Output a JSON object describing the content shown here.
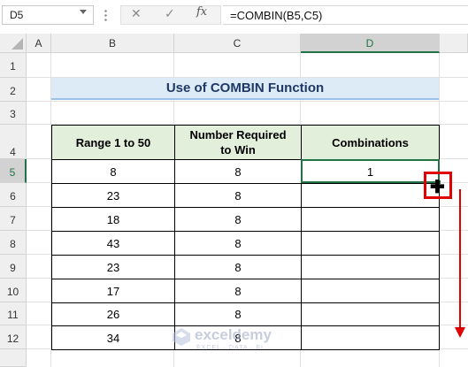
{
  "formula_bar": {
    "name_box": "D5",
    "cancel_icon": "✕",
    "enter_icon": "✓",
    "fx_label": "fx",
    "formula": "=COMBIN(B5,C5)"
  },
  "columns": [
    "A",
    "B",
    "C",
    "D"
  ],
  "rows": [
    "1",
    "2",
    "3",
    "4",
    "5",
    "6",
    "7",
    "8",
    "9",
    "10",
    "11",
    "12"
  ],
  "selected_column": "D",
  "selected_row": "5",
  "title": "Use of COMBIN Function",
  "table": {
    "headers": [
      "Range 1 to 50",
      "Number Required\nto Win",
      "Combinations"
    ],
    "rows": [
      {
        "range": "8",
        "required": "8",
        "combinations": "1"
      },
      {
        "range": "23",
        "required": "8",
        "combinations": ""
      },
      {
        "range": "18",
        "required": "8",
        "combinations": ""
      },
      {
        "range": "43",
        "required": "8",
        "combinations": ""
      },
      {
        "range": "23",
        "required": "8",
        "combinations": ""
      },
      {
        "range": "17",
        "required": "8",
        "combinations": ""
      },
      {
        "range": "26",
        "required": "8",
        "combinations": ""
      },
      {
        "range": "34",
        "required": "8",
        "combinations": ""
      }
    ]
  },
  "annotation": {
    "cursor_icon": "crosshair-plus-icon",
    "highlight_color": "#e00000",
    "arrow_color": "#e00000"
  },
  "watermark": {
    "name": "exceldemy",
    "tagline": "EXCEL · DATA · BI"
  },
  "colors": {
    "title_fill": "#ddebf7",
    "header_fill": "#e2efda",
    "excel_green": "#217346"
  }
}
